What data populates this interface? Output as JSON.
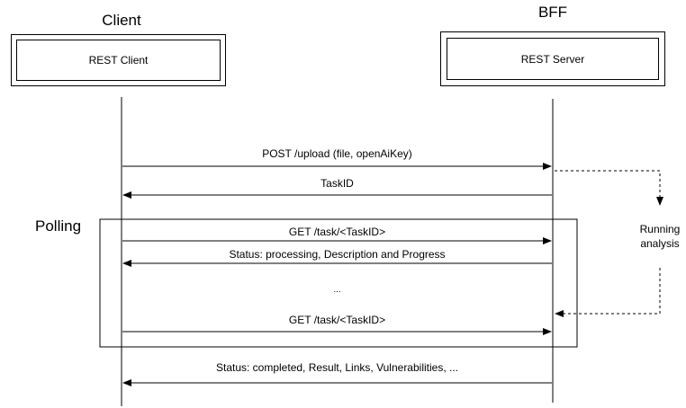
{
  "participants": {
    "client": {
      "title": "Client",
      "box_label": "REST Client"
    },
    "server": {
      "title": "BFF",
      "box_label": "REST Server"
    }
  },
  "polling_label": "Polling",
  "messages": {
    "upload": "POST /upload (file, openAiKey)",
    "task_id": "TaskID",
    "get_task_1": "GET /task/<TaskID>",
    "status_processing": "Status: processing, Description and Progress",
    "ellipsis": "...",
    "get_task_2": "GET /task/<TaskID>",
    "status_completed": "Status: completed, Result, Links, Vulnerabilities, ..."
  },
  "self_note": {
    "line1": "Running",
    "line2": "analysis"
  }
}
